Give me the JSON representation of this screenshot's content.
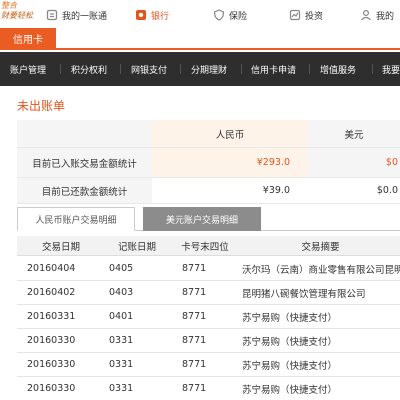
{
  "logo": {
    "line1": "整合",
    "line2": "财要轻松"
  },
  "topnav": [
    {
      "label": "我的一账通",
      "icon": "account-icon",
      "active": false
    },
    {
      "label": "银行",
      "icon": "bank-icon",
      "active": true
    },
    {
      "label": "保险",
      "icon": "insurance-icon",
      "active": false
    },
    {
      "label": "投资",
      "icon": "investment-icon",
      "active": false
    },
    {
      "label": "我的",
      "icon": "user-icon",
      "active": false
    }
  ],
  "card_tab": "信用卡",
  "mainnav": [
    "账户管理",
    "积分权利",
    "网银支付",
    "分期理财",
    "信用卡申请",
    "增值服务",
    "我要"
  ],
  "section_title": "未出账单",
  "summary": {
    "headers": [
      "",
      "人民币",
      "美元"
    ],
    "rows": [
      {
        "label": "目前已入账交易金额统计",
        "rmb": "¥293.0",
        "usd": "$0"
      },
      {
        "label": "目前已还款金额统计",
        "rmb": "¥39.0",
        "usd": "$0.0"
      }
    ]
  },
  "tabs": [
    "人民币账户交易明细",
    "美元账户交易明细"
  ],
  "transactions": {
    "headers": [
      "交易日期",
      "记账日期",
      "卡号末四位",
      "交易摘要"
    ],
    "rows": [
      {
        "trans_date": "20160404",
        "post_date": "0405",
        "card": "8771",
        "desc": "沃尔玛（云南）商业零售有限公司昆明"
      },
      {
        "trans_date": "20160402",
        "post_date": "0403",
        "card": "8771",
        "desc": "昆明猪八碗餐饮管理有限公司"
      },
      {
        "trans_date": "20160331",
        "post_date": "0401",
        "card": "8771",
        "desc": "苏宁易购（快捷支付）"
      },
      {
        "trans_date": "20160330",
        "post_date": "0331",
        "card": "8771",
        "desc": "苏宁易购（快捷支付）"
      },
      {
        "trans_date": "20160330",
        "post_date": "0331",
        "card": "8771",
        "desc": "苏宁易购（快捷支付）"
      },
      {
        "trans_date": "20160330",
        "post_date": "0331",
        "card": "8771",
        "desc": "苏宁易购（快捷支付）"
      }
    ]
  },
  "colors": {
    "accent": "#e95c22",
    "nav_bg": "#2e2e2e",
    "amount_red": "#e6541e"
  }
}
